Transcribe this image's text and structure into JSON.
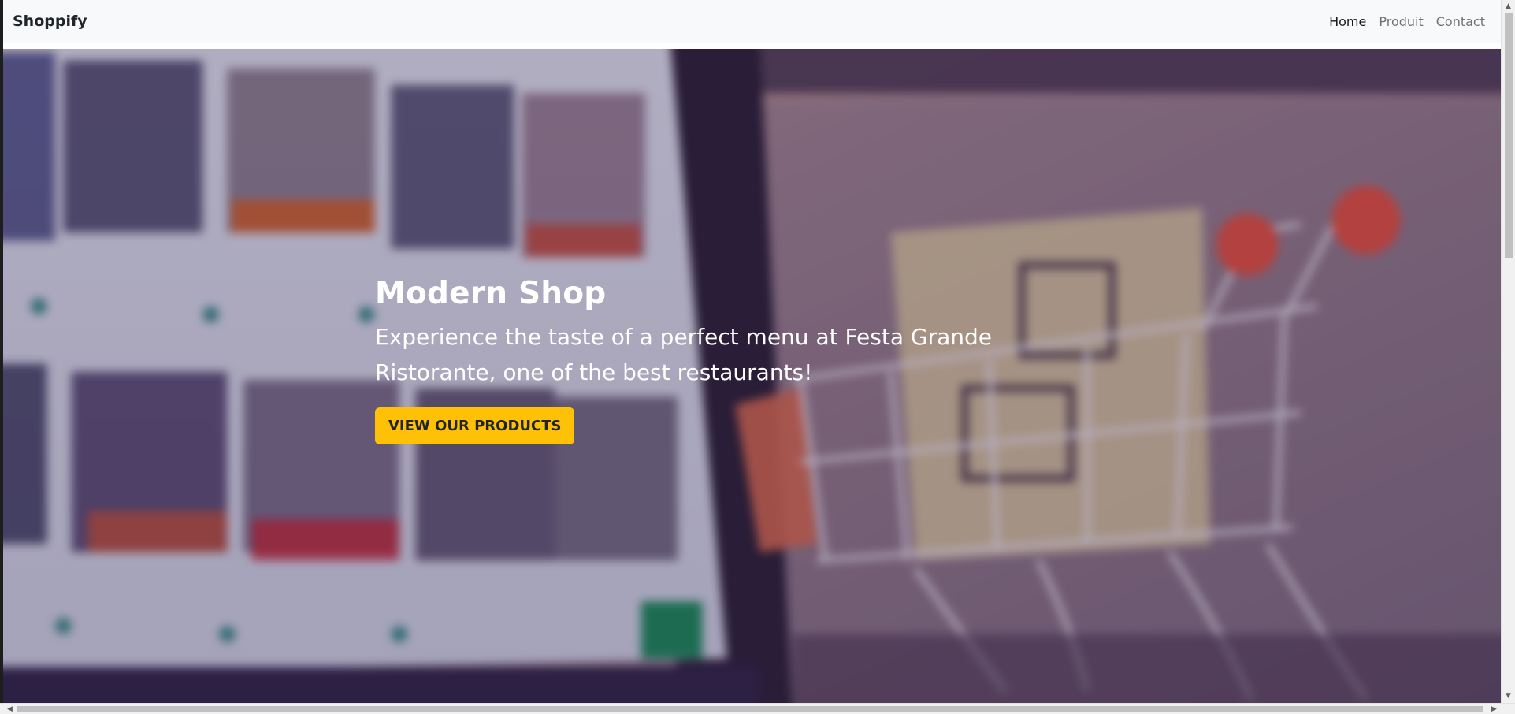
{
  "navbar": {
    "brand": "Shoppify",
    "links": [
      {
        "label": "Home",
        "active": true
      },
      {
        "label": "Produit",
        "active": false
      },
      {
        "label": "Contact",
        "active": false
      }
    ]
  },
  "hero": {
    "title": "Modern Shop",
    "text": "Experience the taste of a perfect menu at Festa Grande Ristorante, one of the best restaurants!",
    "button_label": "VIEW OUR PRODUCTS",
    "button_color": "#ffc107",
    "background_description_icon": "shopping-cart-photo"
  },
  "scrollbars": {
    "up_arrow": "▲",
    "down_arrow": "▼",
    "left_arrow": "◀",
    "right_arrow": "▶"
  }
}
